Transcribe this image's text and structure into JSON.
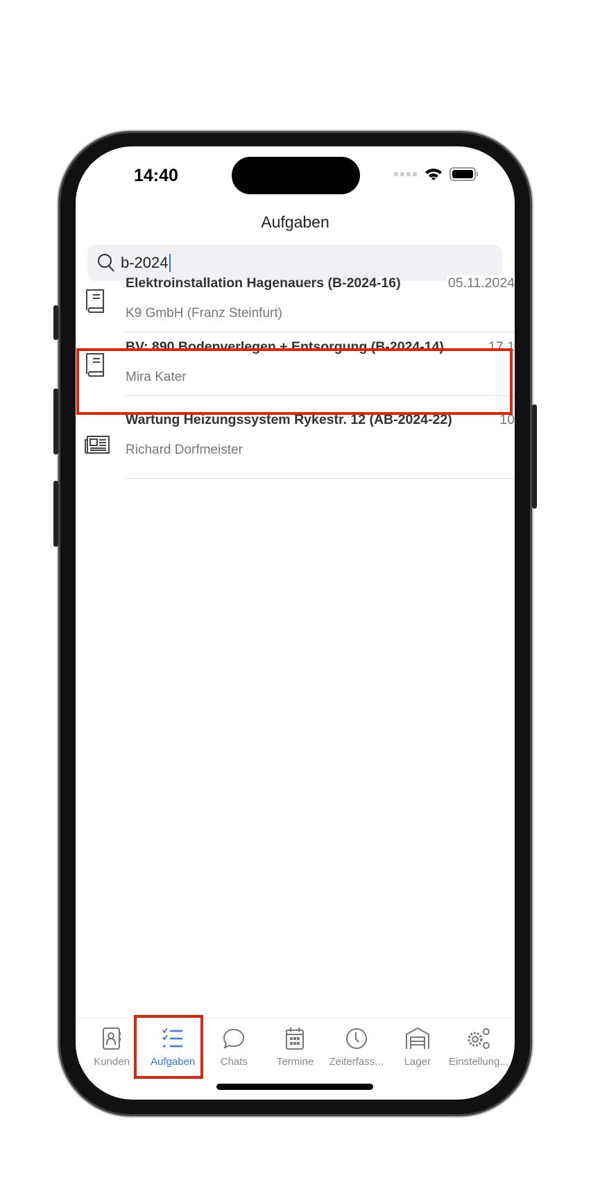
{
  "status_bar": {
    "time": "14:40"
  },
  "header": {
    "title": "Aufgaben"
  },
  "search": {
    "value": "b-2024",
    "icon": "search-icon"
  },
  "tasks": [
    {
      "title": "Elektroinstallation Hagenauers (B-2024-16)",
      "date": "05.11.2024",
      "subtitle": "K9 GmbH (Franz Steinfurt)",
      "icon": "book-icon"
    },
    {
      "title": "BV: 890 Bodenverlegen + Entsorgung (B-2024-14)",
      "date": "17.1",
      "subtitle": "Mira Kater",
      "icon": "book-icon",
      "highlighted": true
    },
    {
      "title": "Wartung Heizungssystem Rykestr. 12 (AB-2024-22)",
      "date": "10",
      "subtitle": "Richard Dorfmeister",
      "icon": "newspaper-icon"
    }
  ],
  "tabbar": {
    "active": "Aufgaben",
    "accent": "#3478f6",
    "items": [
      {
        "label": "Kunden",
        "icon": "contacts-icon"
      },
      {
        "label": "Aufgaben",
        "icon": "checklist-icon"
      },
      {
        "label": "Chats",
        "icon": "chat-bubble-icon"
      },
      {
        "label": "Termine",
        "icon": "calendar-icon"
      },
      {
        "label": "Zeiterfass...",
        "icon": "clock-icon"
      },
      {
        "label": "Lager",
        "icon": "garage-icon"
      },
      {
        "label": "Einstellung...",
        "icon": "gears-icon"
      }
    ]
  },
  "highlight_color": "#e0260a"
}
